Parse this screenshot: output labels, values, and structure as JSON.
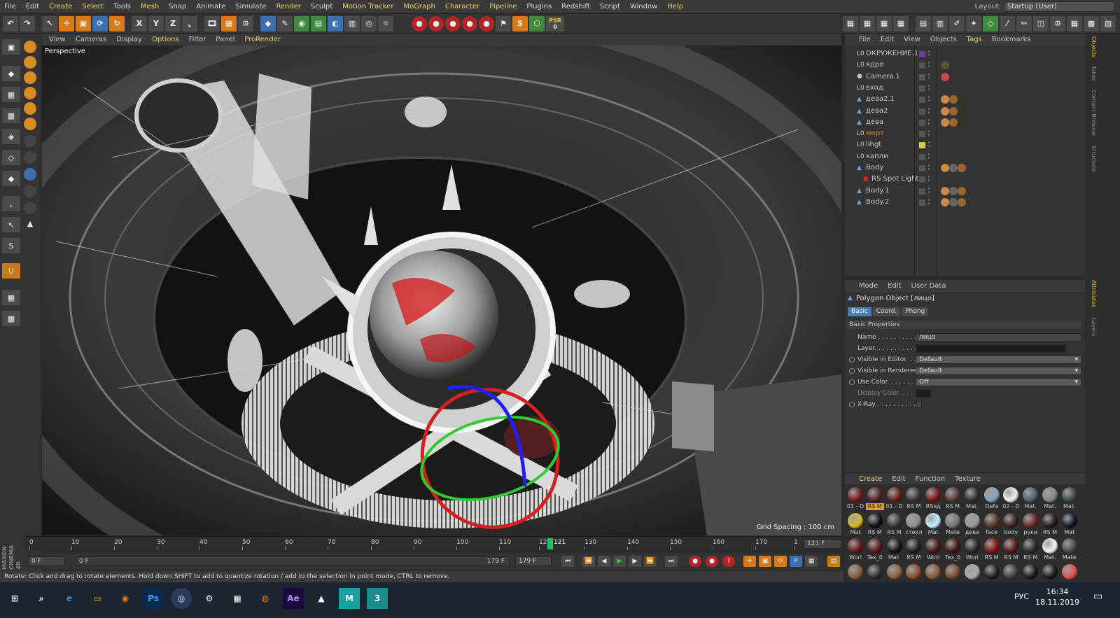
{
  "menu": [
    "File",
    "Edit",
    "Create",
    "Select",
    "Tools",
    "Mesh",
    "Snap",
    "Animate",
    "Simulate",
    "Render",
    "Sculpt",
    "Motion Tracker",
    "MoGraph",
    "Character",
    "Pipeline",
    "Plugins",
    "Redshift",
    "Script",
    "Window",
    "Help"
  ],
  "menu_highlight": [
    "Create",
    "Select",
    "Mesh",
    "Render",
    "Motion Tracker",
    "MoGraph",
    "Character",
    "Pipeline",
    "Help"
  ],
  "layout": {
    "label": "Layout:",
    "value": "Startup (User)"
  },
  "toolbar": {
    "x": "X",
    "y": "Y",
    "z": "Z",
    "psr_label": "PSR",
    "psr_value": "0",
    "s_label": "S"
  },
  "viewport": {
    "menu": [
      "View",
      "Cameras",
      "Display",
      "Options",
      "Filter",
      "Panel",
      "ProRender"
    ],
    "menu_highlight": [
      "Options",
      "ProRender"
    ],
    "label": "Perspective",
    "grid_spacing": "Grid Spacing : 100 cm"
  },
  "timeline": {
    "ticks": [
      "0",
      "10",
      "20",
      "30",
      "40",
      "50",
      "60",
      "70",
      "80",
      "90",
      "100",
      "110",
      "12",
      "130",
      "140",
      "150",
      "160",
      "170",
      "1"
    ],
    "current_frame": "121",
    "frame_end": "121 F"
  },
  "transport": {
    "start": "0 F",
    "range_start": "0 F",
    "range_end": "179 F",
    "end": "179 F"
  },
  "status": "Rotate: Click and drag to rotate elements. Hold down SHIFT to add to quantize rotation / add to the selection in point mode, CTRL to remove.",
  "brand": {
    "line1": "MAXON",
    "line2": "CINEMA 4D"
  },
  "objects_menu": [
    "File",
    "Edit",
    "View",
    "Objects",
    "Tags",
    "Bookmarks"
  ],
  "objects_menu_highlight": [
    "Tags"
  ],
  "objects": [
    {
      "name": "ОКРУЖЕНИЕ.1",
      "icon": "null-icon",
      "color": "#6a3fa0"
    },
    {
      "name": "ядро",
      "icon": "null-icon",
      "color": ""
    },
    {
      "name": "Camera.1",
      "icon": "camera-icon",
      "color": ""
    },
    {
      "name": "вход",
      "icon": "null-icon",
      "color": ""
    },
    {
      "name": "дева2.1",
      "icon": "figure-icon",
      "color": ""
    },
    {
      "name": "дева2",
      "icon": "figure-icon",
      "color": ""
    },
    {
      "name": "дева",
      "icon": "figure-icon",
      "color": ""
    },
    {
      "name": "мерт",
      "icon": "null-icon",
      "color": "",
      "text_color": "#d08a30"
    },
    {
      "name": "lihgt",
      "icon": "null-icon",
      "color": "#d8d020"
    },
    {
      "name": "капли",
      "icon": "null-icon",
      "color": ""
    },
    {
      "name": "Body",
      "icon": "figure-icon",
      "color": ""
    },
    {
      "name": "RS Spot Light",
      "icon": "rs-light-icon",
      "color": ""
    },
    {
      "name": "Body.1",
      "icon": "figure-icon",
      "color": ""
    },
    {
      "name": "Body.2",
      "icon": "figure-icon",
      "color": ""
    }
  ],
  "attributes": {
    "menu": [
      "Mode",
      "Edit",
      "User Data"
    ],
    "title": "Polygon Object [лицо]",
    "tabs": [
      "Basic",
      "Coord.",
      "Phong"
    ],
    "active_tab": "Basic",
    "section": "Basic Properties",
    "rows": [
      {
        "label": "Name . . . . . . . . . .",
        "value": "лицо",
        "type": "text",
        "radio": false
      },
      {
        "label": "Layer. . . . . . . . . . .",
        "value": "",
        "type": "empty",
        "radio": false
      },
      {
        "label": "Visible in Editor. . .",
        "value": "Default",
        "type": "drop",
        "radio": true
      },
      {
        "label": "Visible in Renderer",
        "value": "Default",
        "type": "drop",
        "radio": true
      },
      {
        "label": "Use Color. . . . . . . .",
        "value": "Off",
        "type": "drop",
        "radio": true
      },
      {
        "label": "Display Color. . . .",
        "value": "",
        "type": "swatch",
        "radio": false,
        "dim": true
      },
      {
        "label": "X-Ray . . . . . . . . . .",
        "value": "",
        "type": "check",
        "radio": true
      }
    ]
  },
  "materials_menu": [
    "Create",
    "Edit",
    "Function",
    "Texture"
  ],
  "materials_menu_highlight": [
    "Create"
  ],
  "materials": [
    [
      {
        "label": "01 - D",
        "color": "#7a1a1a"
      },
      {
        "label": "RS M",
        "color": "#5a2222",
        "selected": true
      },
      {
        "label": "01 - D",
        "color": "#6a2020"
      },
      {
        "label": "RS M",
        "color": "#3a3a3a"
      },
      {
        "label": "RSяд",
        "color": "#7a1515"
      },
      {
        "label": "RS M",
        "color": "#5a3a3a"
      },
      {
        "label": "Mat.",
        "color": "#303030"
      },
      {
        "label": "Defa",
        "color": "#8aa0b8"
      },
      {
        "label": "02 - D",
        "color": "#f0f0f0"
      },
      {
        "label": "Mat.",
        "color": "#506070"
      },
      {
        "label": "Mat.",
        "color": "#888888"
      },
      {
        "label": "Mat.",
        "color": "#3a4a4a"
      }
    ],
    [
      {
        "label": "Mat",
        "color": "#d8b820"
      },
      {
        "label": "RS M",
        "color": "#111111"
      },
      {
        "label": "RS M",
        "color": "#3a3a3a"
      },
      {
        "label": "стекл",
        "color": "#909090"
      },
      {
        "label": "Mat",
        "color": "#c0f0ff"
      },
      {
        "label": "Mate",
        "color": "#777777"
      },
      {
        "label": "дева",
        "color": "#999999"
      },
      {
        "label": "face",
        "color": "#5a3a2a"
      },
      {
        "label": "body",
        "color": "#3a2020"
      },
      {
        "label": "руки",
        "color": "#6a2a2a"
      },
      {
        "label": "RS M",
        "color": "#2a1a1a"
      },
      {
        "label": "Mat",
        "color": "#111820"
      }
    ],
    [
      {
        "label": "Worl",
        "color": "#6a1a1a"
      },
      {
        "label": "Tex_0",
        "color": "#5a1a1a"
      },
      {
        "label": "Mat.",
        "color": "#151515"
      },
      {
        "label": "RS M",
        "color": "#252525"
      },
      {
        "label": "Worl",
        "color": "#4a1a1a"
      },
      {
        "label": "Tex_0",
        "color": "#4a1515"
      },
      {
        "label": "Worl",
        "color": "#2a2a2a"
      },
      {
        "label": "RS M",
        "color": "#8a1010"
      },
      {
        "label": "RS M",
        "color": "#5a1a1a"
      },
      {
        "label": "RS M",
        "color": "#2a2a2a"
      },
      {
        "label": "Mat.",
        "color": "#f5f5f5"
      },
      {
        "label": "Mate",
        "color": "#4a4a4a"
      }
    ],
    [
      {
        "label": "",
        "color": "#8a5a3a"
      },
      {
        "label": "",
        "color": "#303030"
      },
      {
        "label": "",
        "color": "#8a6040"
      },
      {
        "label": "",
        "color": "#8a5030"
      },
      {
        "label": "",
        "color": "#8a5a3a"
      },
      {
        "label": "",
        "color": "#7a4a2a"
      },
      {
        "label": "",
        "color": "#aaaaaa"
      },
      {
        "label": "",
        "color": "#202020"
      },
      {
        "label": "",
        "color": "#404040"
      },
      {
        "label": "",
        "color": "#1a1a1a"
      },
      {
        "label": "",
        "color": "#1a1a1a"
      },
      {
        "label": "",
        "color": "#e05050"
      }
    ]
  ],
  "side_tabs": [
    "Objects",
    "Takes",
    "Content Browser",
    "Structure",
    "Attributes",
    "Layers"
  ],
  "side_tabs_active": [
    "Objects",
    "Attributes"
  ],
  "taskbar": {
    "apps": [
      "windows-start-icon",
      "search-icon",
      "edge-icon",
      "file-explorer-icon",
      "blender-icon",
      "photoshop-icon",
      "cinema4d-icon",
      "settings-icon",
      "calculator-icon",
      "firefox-icon",
      "after-effects-icon",
      "photos-icon",
      "maya-icon",
      "3ds-icon"
    ],
    "ps_label": "Ps",
    "ae_label": "Ae",
    "m_label": "M",
    "three_label": "3",
    "lang": "РУС",
    "time": "16:34",
    "date": "18.11.2019"
  }
}
